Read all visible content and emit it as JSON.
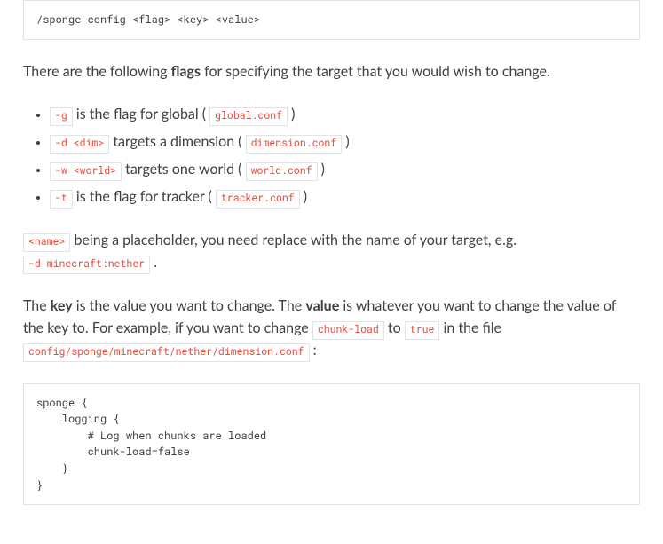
{
  "command_block": "/sponge config <flag> <key> <value>",
  "intro_before": "There are the following ",
  "intro_strong": "flags",
  "intro_after": " for specifying the target that you would wish to change.",
  "flags": [
    {
      "flag": "-g",
      "mid_before": " is the flag for global ( ",
      "file": "global.conf",
      "mid_after": " )"
    },
    {
      "flag": "-d <dim>",
      "mid_before": " targets a dimension ( ",
      "file": "dimension.conf",
      "mid_after": " )"
    },
    {
      "flag": "-w <world>",
      "mid_before": " targets one world ( ",
      "file": "world.conf",
      "mid_after": " )"
    },
    {
      "flag": "-t",
      "mid_before": " is the flag for tracker ( ",
      "file": "tracker.conf",
      "mid_after": " )"
    }
  ],
  "p2": {
    "name_code": "<name>",
    "text1": " being a placeholder, you need replace with the name of your target, e.g. ",
    "example_code": "-d minecraft:nether",
    "text2": " ."
  },
  "p3": {
    "t1": "The ",
    "s1": "key",
    "t2": " is the value you want to change. The ",
    "s2": "value",
    "t3": " is whatever you want to change the value of the key to. For example, if you want to change ",
    "c1": "chunk-load",
    "t4": " to ",
    "c2": "true",
    "t5": " in the file ",
    "c3": "config/sponge/minecraft/nether/dimension.conf",
    "t6": " :"
  },
  "config_block": "sponge {\n    logging {\n        # Log when chunks are loaded\n        chunk-load=false\n    }\n}"
}
